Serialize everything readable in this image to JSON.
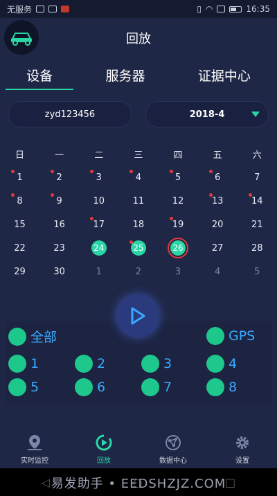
{
  "statusbar": {
    "carrier": "无服务",
    "time": "16:35"
  },
  "header": {
    "title": "回放"
  },
  "tabs": [
    {
      "label": "设备",
      "active": true
    },
    {
      "label": "服务器",
      "active": false
    },
    {
      "label": "证据中心",
      "active": false
    }
  ],
  "selectors": {
    "device": "zyd123456",
    "month": "2018-4"
  },
  "calendar": {
    "weekdays": [
      "日",
      "一",
      "二",
      "三",
      "四",
      "五",
      "六"
    ],
    "rows": [
      [
        "1",
        "2",
        "3",
        "4",
        "5",
        "6",
        "7"
      ],
      [
        "8",
        "9",
        "10",
        "11",
        "12",
        "13",
        "14"
      ],
      [
        "15",
        "16",
        "17",
        "18",
        "19",
        "20",
        "21"
      ],
      [
        "22",
        "23",
        "24",
        "25",
        "26",
        "27",
        "28"
      ],
      [
        "29",
        "30",
        "1",
        "2",
        "3",
        "4",
        "5"
      ]
    ]
  },
  "channels": {
    "all": "全部",
    "gps": "GPS",
    "items": [
      "1",
      "2",
      "3",
      "4",
      "5",
      "6",
      "7",
      "8"
    ]
  },
  "nav": [
    {
      "label": "实时监控"
    },
    {
      "label": "回放"
    },
    {
      "label": "数据中心"
    },
    {
      "label": "设置"
    }
  ],
  "watermark": "易发助手 • EEDSHZJZ.COM",
  "colors": {
    "accent": "#2ad6a6",
    "marker": "#e03a3a",
    "channel": "#1ec88d",
    "link": "#3aa8ff"
  }
}
